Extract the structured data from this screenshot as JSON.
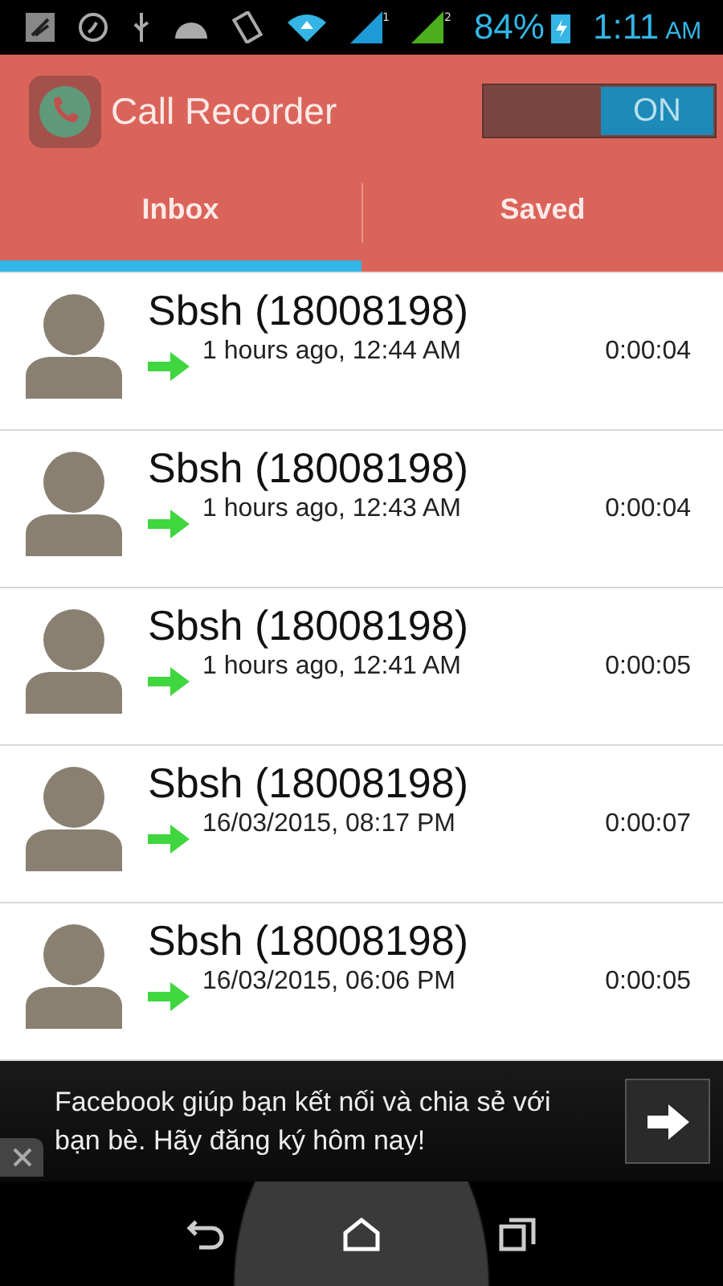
{
  "status_bar": {
    "signals": [
      {
        "label": "1",
        "color": "#1e9ad6"
      },
      {
        "label": "2",
        "color": "#4cae1c"
      }
    ],
    "battery": "84%",
    "time": "1:11",
    "meridiem": "AM"
  },
  "app_bar": {
    "title": "Call Recorder",
    "toggle": {
      "label": "ON",
      "on": true
    }
  },
  "tabs": [
    {
      "label": "Inbox",
      "selected": true
    },
    {
      "label": "Saved",
      "selected": false
    }
  ],
  "calls": [
    {
      "name": "Sbsh (18008198)",
      "when": "1 hours ago, 12:44 AM",
      "duration": "0:00:04"
    },
    {
      "name": "Sbsh (18008198)",
      "when": "1 hours ago, 12:43 AM",
      "duration": "0:00:04"
    },
    {
      "name": "Sbsh (18008198)",
      "when": "1 hours ago, 12:41 AM",
      "duration": "0:00:05"
    },
    {
      "name": "Sbsh (18008198)",
      "when": "16/03/2015, 08:17 PM",
      "duration": "0:00:07"
    },
    {
      "name": "Sbsh (18008198)",
      "when": "16/03/2015, 06:06 PM",
      "duration": "0:00:05"
    }
  ],
  "ad": {
    "text": "Facebook giúp bạn kết nối và chia sẻ với bạn bè. Hãy đăng ký hôm nay!"
  }
}
